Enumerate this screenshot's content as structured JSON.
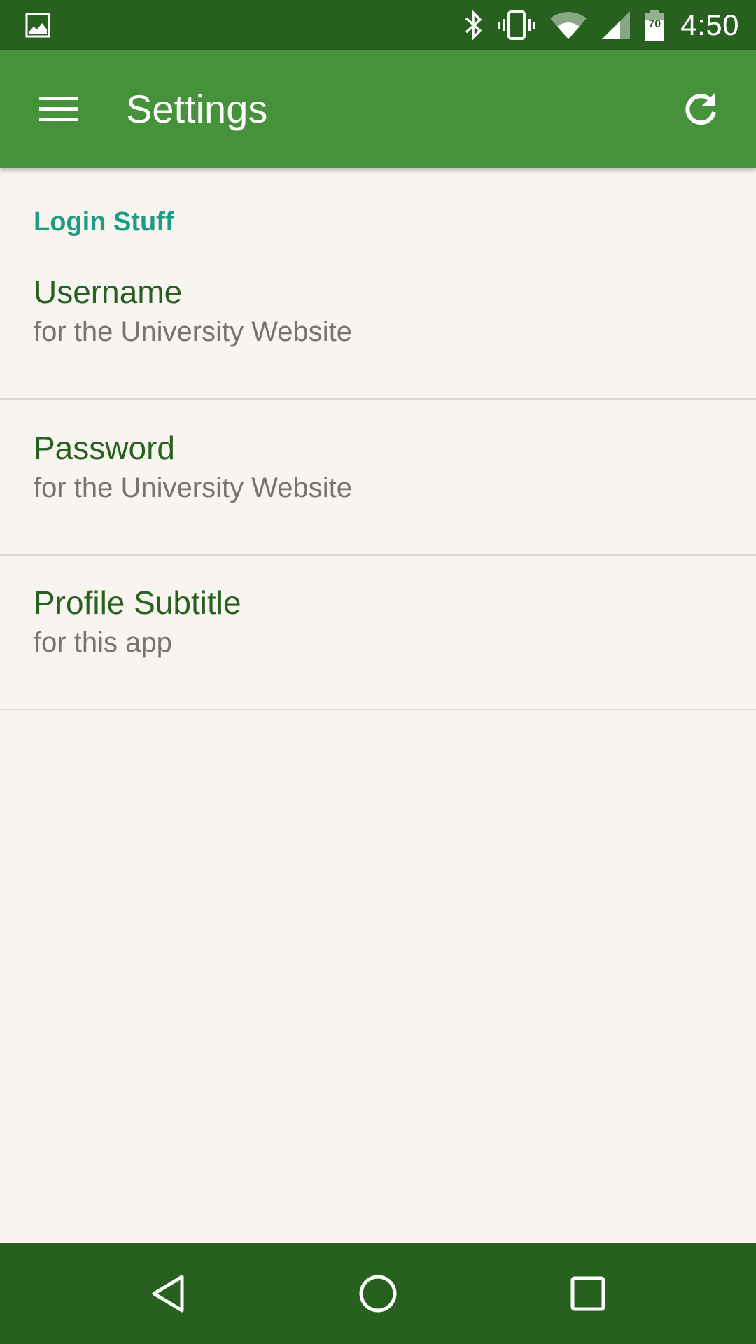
{
  "status_bar": {
    "time": "4:50",
    "battery_level": "70",
    "icons": [
      "image-notification-icon",
      "bluetooth-icon",
      "vibrate-icon",
      "wifi-icon",
      "cell-signal-icon",
      "battery-icon"
    ]
  },
  "app_bar": {
    "title": "Settings",
    "menu_icon": "hamburger-menu-icon",
    "refresh_icon": "refresh-icon"
  },
  "settings": {
    "category": "Login Stuff",
    "items": [
      {
        "title": "Username",
        "summary": "for the University Website"
      },
      {
        "title": "Password",
        "summary": "for the University Website"
      },
      {
        "title": "Profile Subtitle",
        "summary": "for this app"
      }
    ]
  },
  "nav_bar": {
    "icons": [
      "back-icon",
      "home-icon",
      "recents-icon"
    ]
  },
  "colors": {
    "status_bar": "#27601F",
    "app_bar": "#45923B",
    "background": "#F8F4EF",
    "category_text": "#1C9C84",
    "title_text": "#27601F",
    "summary_text": "#777370",
    "divider": "#DAD8D4"
  }
}
